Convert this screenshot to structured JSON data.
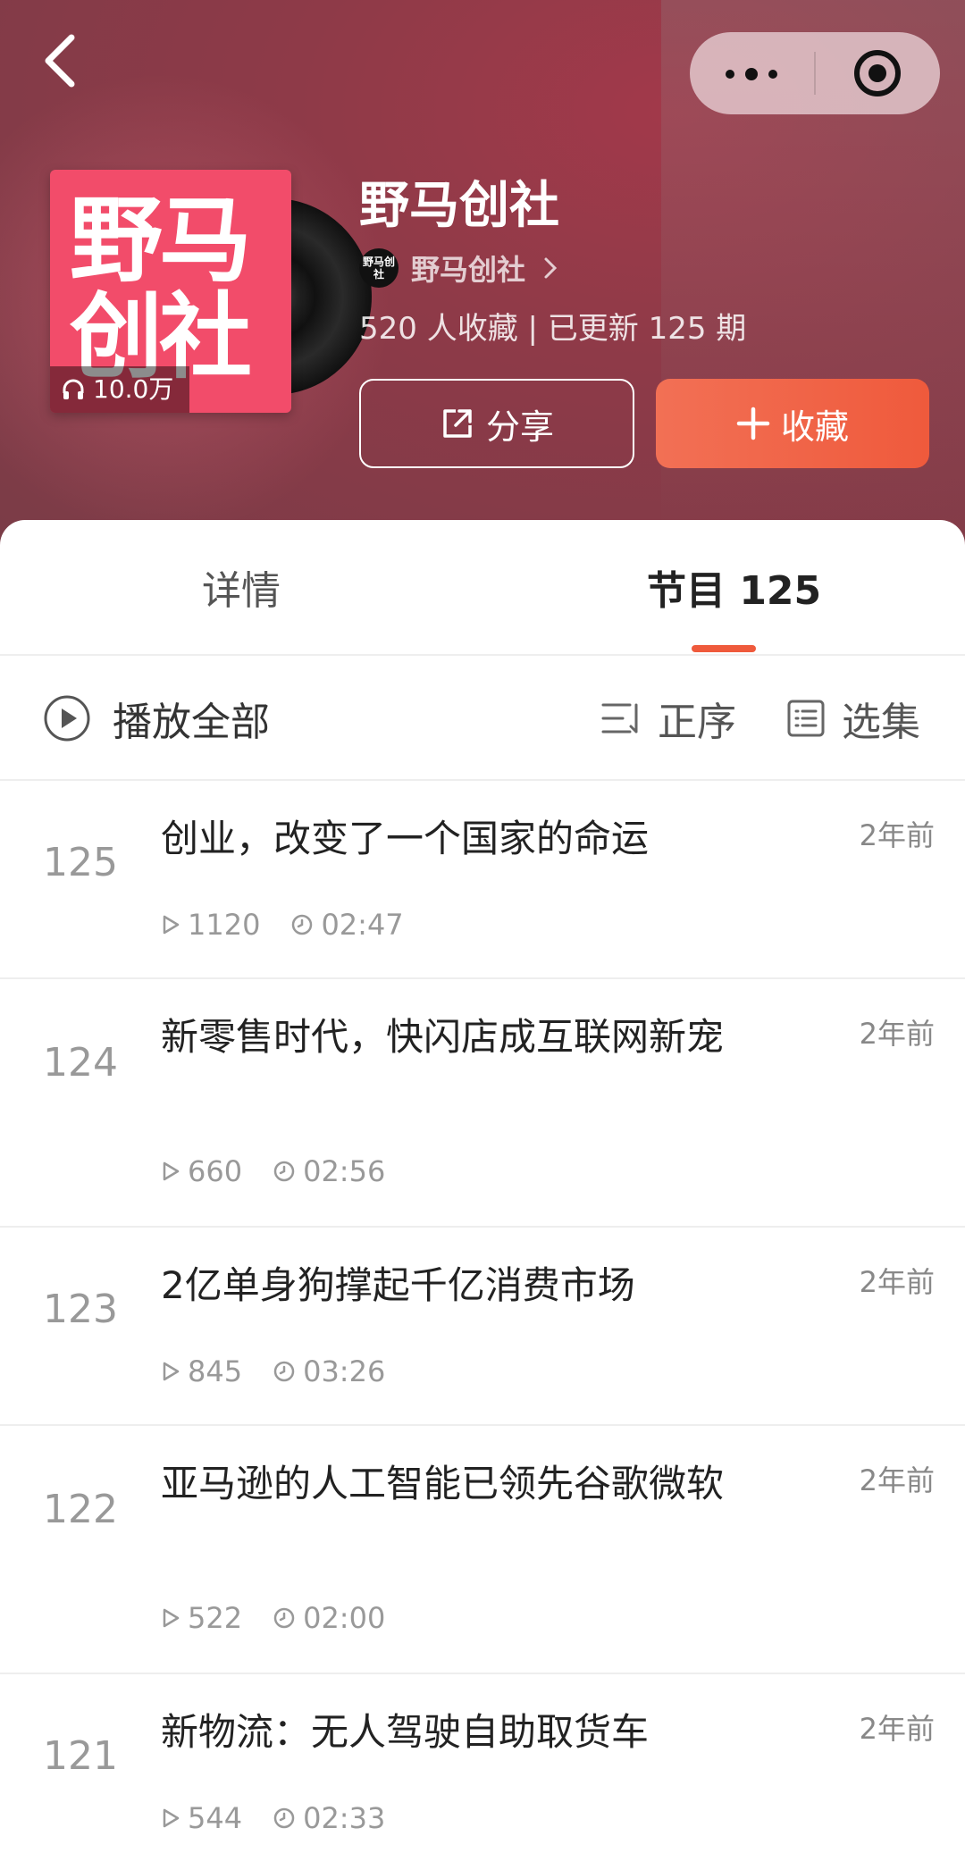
{
  "header": {
    "title": "野马创社",
    "author_name": "野马创社",
    "author_avatar_text": "野马创社",
    "stats": "520 人收藏 | 已更新 125 期",
    "cover_text_line1": "野马",
    "cover_text_line2": "创社",
    "play_count": "10.0万",
    "share_label": "分享",
    "favorite_label": "收藏"
  },
  "tabs": {
    "detail": "详情",
    "episodes": "节目 125"
  },
  "toolbar": {
    "play_all": "播放全部",
    "sort": "正序",
    "select": "选集"
  },
  "episodes": [
    {
      "num": "125",
      "title": "创业，改变了一个国家的命运",
      "ago": "2年前",
      "plays": "1120",
      "duration": "02:47"
    },
    {
      "num": "124",
      "title": "新零售时代，快闪店成互联网新宠",
      "ago": "2年前",
      "plays": "660",
      "duration": "02:56"
    },
    {
      "num": "123",
      "title": "2亿单身狗撑起千亿消费市场",
      "ago": "2年前",
      "plays": "845",
      "duration": "03:26"
    },
    {
      "num": "122",
      "title": "亚马逊的人工智能已领先谷歌微软",
      "ago": "2年前",
      "plays": "522",
      "duration": "02:00"
    },
    {
      "num": "121",
      "title": "新物流：无人驾驶自助取货车",
      "ago": "2年前",
      "plays": "544",
      "duration": "02:33"
    }
  ],
  "colors": {
    "accent": "#ef5a3c",
    "cover": "#f24c6a",
    "header_bg": "#8e3a48"
  }
}
